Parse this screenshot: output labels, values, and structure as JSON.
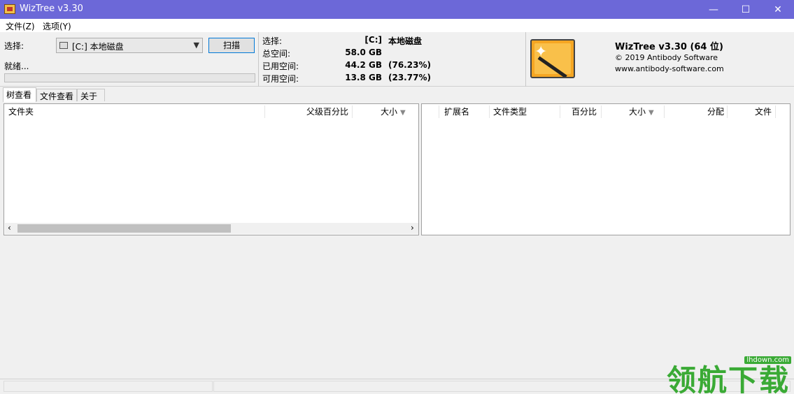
{
  "window": {
    "title": "WizTree v3.30",
    "min": "—",
    "max": "☐",
    "close": "✕"
  },
  "menu": {
    "file": "文件(Z)",
    "options": "选项(Y)"
  },
  "left": {
    "select_label": "选择:",
    "drive_value": "[C:] 本地磁盘",
    "scan_button": "扫描",
    "status": "就绪..."
  },
  "stats": {
    "select_label": "选择:",
    "select_drive": "[C:]",
    "select_name": "本地磁盘",
    "total_label": "总空间:",
    "total_value": "58.0 GB",
    "used_label": "已用空间:",
    "used_value": "44.2 GB",
    "used_pct": "(76.23%)",
    "free_label": "可用空间:",
    "free_value": "13.8 GB",
    "free_pct": "(23.77%)"
  },
  "about": {
    "product": "WizTree v3.30 (64 位)",
    "copyright": "© 2019 Antibody Software",
    "url": "www.antibody-software.com"
  },
  "tabs": [
    "树查看",
    "文件查看",
    "关于"
  ],
  "tree_columns": {
    "folder": "文件夹",
    "parent_pct": "父级百分比",
    "size": "大小"
  },
  "ext_columns": {
    "ext": "扩展名",
    "type": "文件类型",
    "pct": "百分比",
    "size": "大小",
    "alloc": "分配",
    "files": "文件"
  },
  "scroll": {
    "left": "‹",
    "right": "›"
  },
  "watermark": {
    "text": "领航下载",
    "url": "lhdown.com"
  }
}
